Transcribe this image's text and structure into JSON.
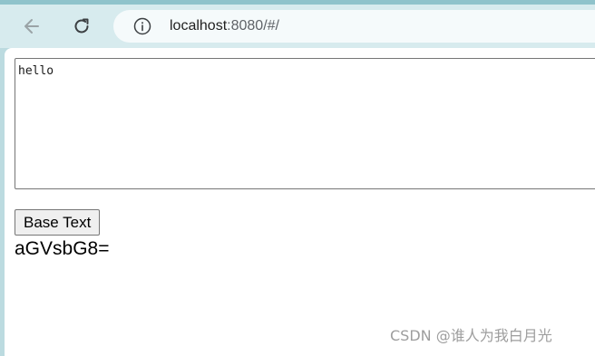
{
  "browser": {
    "address": {
      "host": "localhost",
      "rest": ":8080/#/"
    },
    "icons": {
      "back": "arrow-left-icon",
      "reload": "reload-icon",
      "site_info": "info-icon"
    }
  },
  "page": {
    "textarea_value": "hello",
    "button_label": "Base Text",
    "output_text": "aGVsbG8="
  },
  "watermark": {
    "text": "CSDN @谁人为我白月光"
  }
}
